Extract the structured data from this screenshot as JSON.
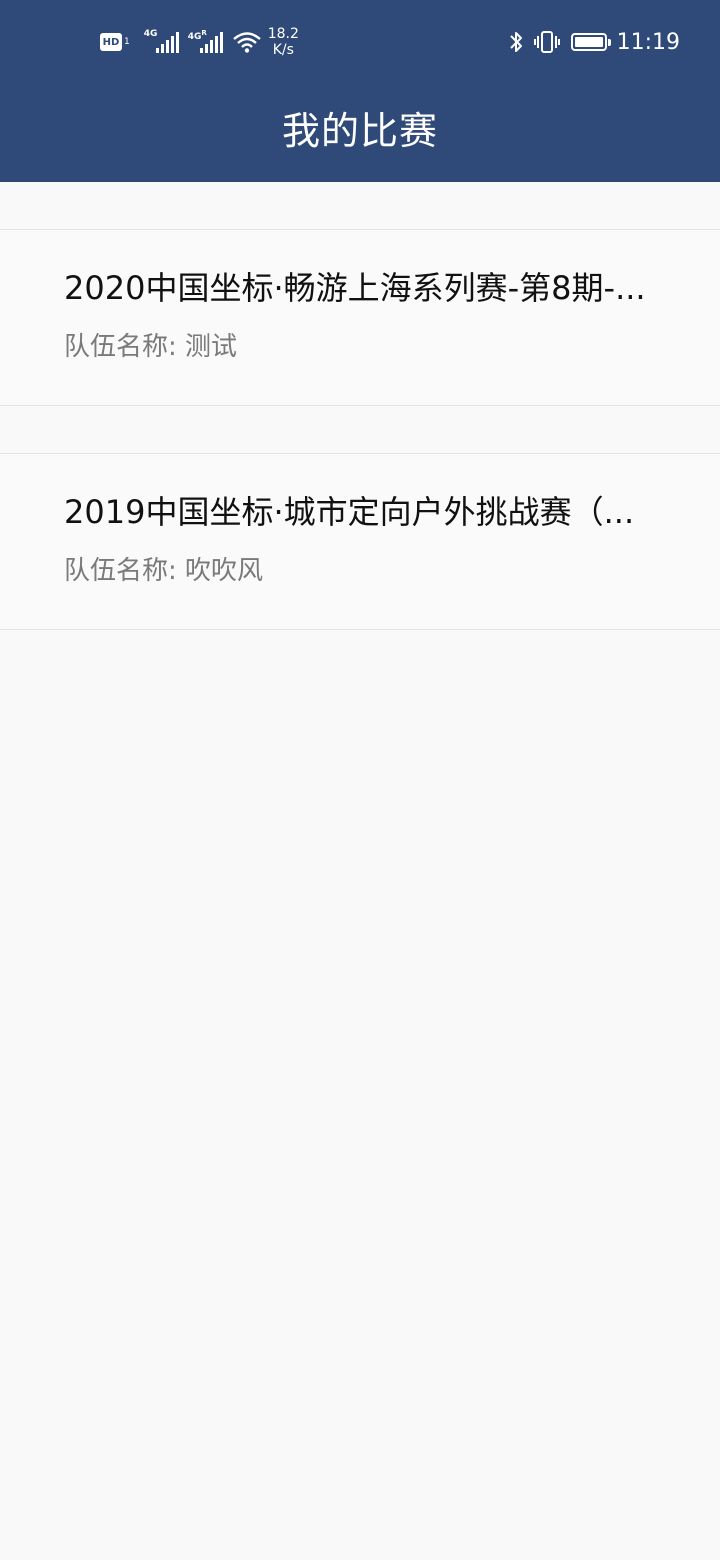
{
  "status_bar": {
    "hd_label": "HD",
    "sim_label": "1",
    "network1": "4G",
    "network2": "4G",
    "network2_sup": "R",
    "speed_value": "18.2",
    "speed_unit": "K/s",
    "time": "11:19"
  },
  "header": {
    "title": "我的比赛",
    "background_color": "#2f4a78"
  },
  "matches": [
    {
      "title": "2020中国坐标·畅游上海系列赛-第8期-...",
      "team_label": "队伍名称: ",
      "team_name": "测试"
    },
    {
      "title": "2019中国坐标·城市定向户外挑战赛（...",
      "team_label": "队伍名称: ",
      "team_name": "吹吹风"
    }
  ]
}
